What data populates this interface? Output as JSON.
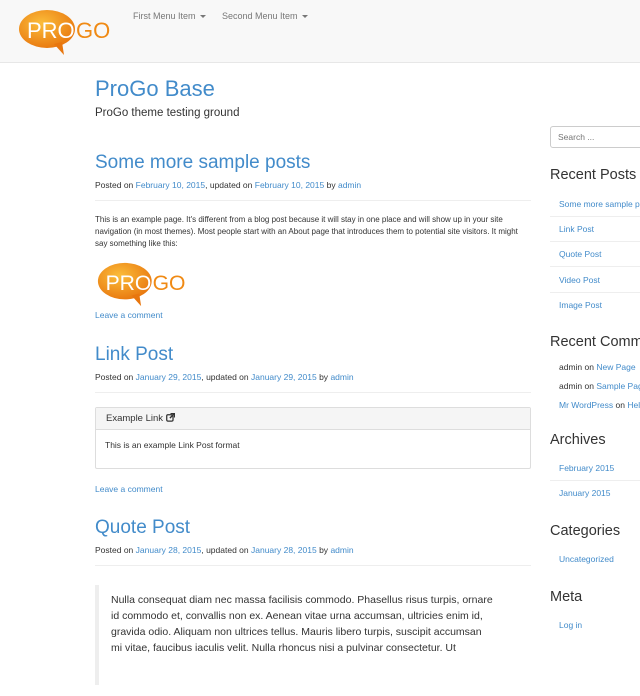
{
  "navbar": {
    "logo_text_a": "PRO",
    "logo_text_b": "GO",
    "menu": [
      "First Menu Item",
      "Second Menu Item"
    ]
  },
  "site": {
    "title": "ProGo Base",
    "description": "ProGo theme testing ground"
  },
  "posts": [
    {
      "title": "Some more sample posts",
      "meta_prefix": "Posted on",
      "date": "February 10, 2015",
      "updated_prefix": ", updated on",
      "updated": "February 10, 2015",
      "by": "by",
      "author": "admin",
      "body": "This is an example page. It's different from a blog post because it will stay in one place and will show up in your site navigation (in most themes). Most people start with an About page that introduces them to potential site visitors. It might say something like this:",
      "comment_link": "Leave a comment"
    },
    {
      "title": "Link Post",
      "meta_prefix": "Posted on",
      "date": "January 29, 2015",
      "updated_prefix": ", updated on",
      "updated": "January 29, 2015",
      "by": "by",
      "author": "admin",
      "panel_title": "Example Link",
      "panel_body": "This is an example Link Post format",
      "comment_link": "Leave a comment"
    },
    {
      "title": "Quote Post",
      "meta_prefix": "Posted on",
      "date": "January 28, 2015",
      "updated_prefix": ", updated on",
      "updated": "January 28, 2015",
      "by": "by",
      "author": "admin",
      "quote_lines": [
        "Nulla consequat diam nec massa facilisis commodo. Phasellus risus turpis, ornare",
        "id commodo et, convallis non ex. Aenean vitae urna accumsan, ultricies enim id,",
        "gravida odio. Aliquam non ultrices tellus. Mauris libero turpis, suscipit accumsan",
        "mi vitae, faucibus iaculis velit. Nulla rhoncus nisi a pulvinar consectetur. Ut"
      ]
    }
  ],
  "sidebar": {
    "search_placeholder": "Search ...",
    "recent_posts_title": "Recent Posts",
    "recent_posts": [
      "Some more sample posts",
      "Link Post",
      "Quote Post",
      "Video Post",
      "Image Post"
    ],
    "recent_comments_title": "Recent Comments",
    "recent_comments": [
      {
        "author": "admin",
        "on": "on",
        "post": "New Page"
      },
      {
        "author": "admin",
        "on": "on",
        "post": "Sample Page"
      },
      {
        "author": "Mr WordPress",
        "on": "on",
        "post": "Hello world!"
      }
    ],
    "archives_title": "Archives",
    "archives": [
      "February 2015",
      "January 2015"
    ],
    "categories_title": "Categories",
    "categories": [
      "Uncategorized"
    ],
    "meta_title": "Meta",
    "meta": [
      "Log in"
    ]
  },
  "colors": {
    "link": "#428bca",
    "logo_orange": "#f39c12",
    "navbar_bg": "#f8f8f8"
  }
}
